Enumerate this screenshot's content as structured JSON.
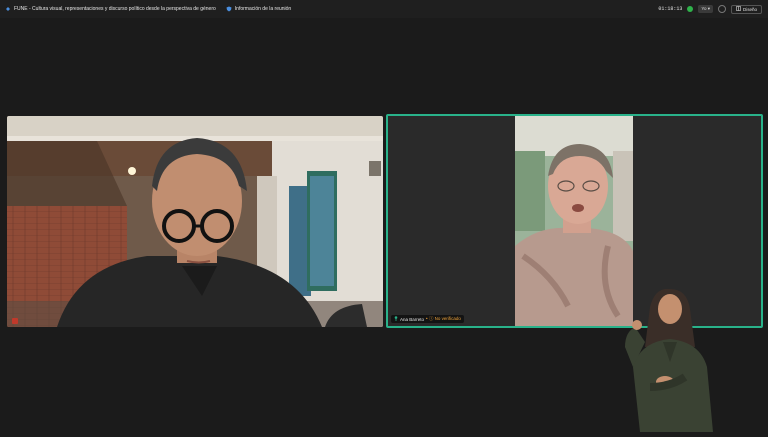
{
  "topbar": {
    "meeting_title": "FUNE - Cultura visual, representaciones y discurso político desde la perspectiva de género",
    "meeting_info": "Información de la reunión",
    "timer": "01:18:13",
    "ctrl_label": "Yo ▾",
    "layout_button": "Diseño"
  },
  "participants": [
    {
      "name": "",
      "mic_muted": true
    },
    {
      "name": "Ana Barreto",
      "status": "No verificado"
    }
  ],
  "colors": {
    "accent": "#29b28a",
    "brand": "#4a8fe0",
    "warning": "#f0a43a"
  }
}
